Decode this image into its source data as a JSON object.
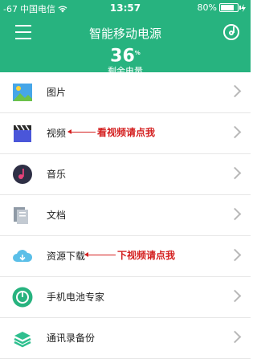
{
  "status_bar": {
    "signal": "-67",
    "carrier": "中国电信",
    "time": "13:57",
    "battery": "80%",
    "battery_level": 0.8
  },
  "header": {
    "title": "智能移动电源",
    "big_value": "36",
    "big_value_sup": "%",
    "sub_label": "剩余电量"
  },
  "list": {
    "items": [
      {
        "label": "图片",
        "icon": "picture-icon"
      },
      {
        "label": "视频",
        "icon": "clapperboard-icon",
        "annotation": "看视频请点我"
      },
      {
        "label": "音乐",
        "icon": "music-icon"
      },
      {
        "label": "文档",
        "icon": "document-icon"
      },
      {
        "label": "资源下载",
        "icon": "cloud-download-icon",
        "annotation": "下视频请点我"
      },
      {
        "label": "手机电池专家",
        "icon": "battery-expert-icon"
      },
      {
        "label": "通讯录备份",
        "icon": "layers-icon"
      }
    ]
  },
  "colors": {
    "header_bg": "#27b37f",
    "annotation": "#d42020"
  }
}
